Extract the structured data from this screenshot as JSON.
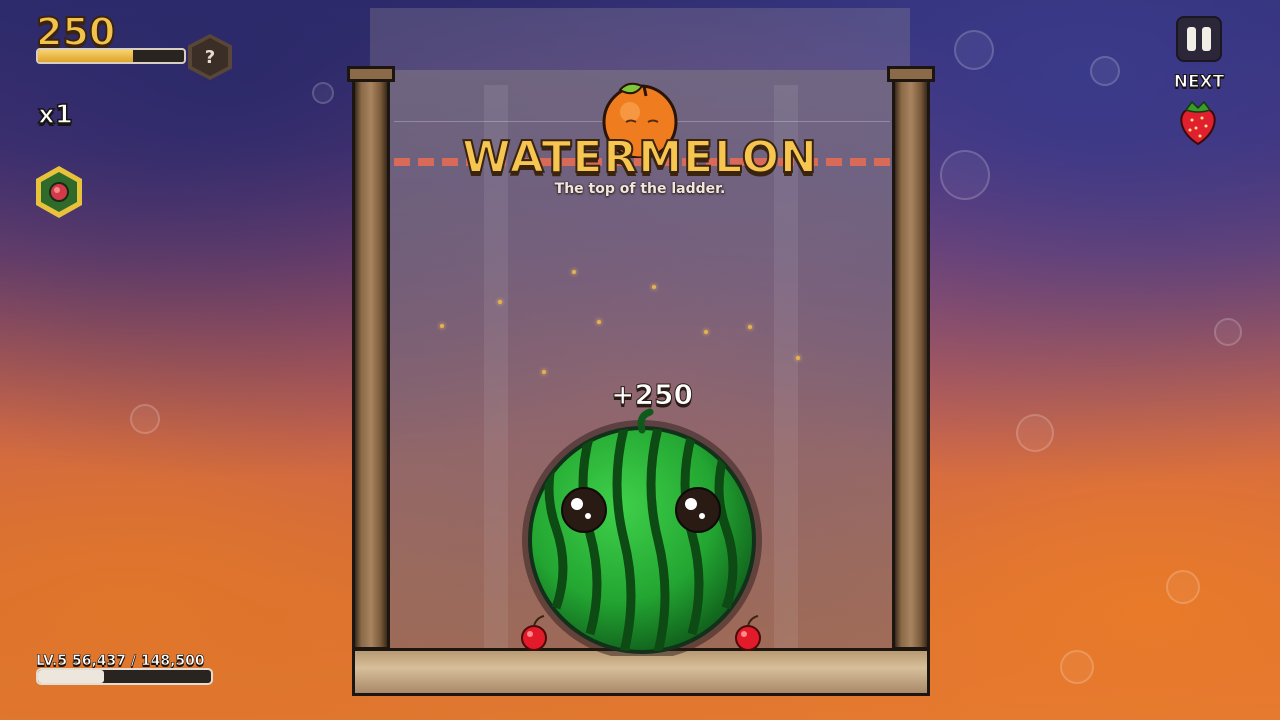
{
  "hud": {
    "score": "250",
    "score_progress": 0.65,
    "mystery_badge_label": "?",
    "multiplier": "x1",
    "powerup_icon": "melon-powerup-icon",
    "pause_icon": "pause-icon",
    "next_label": "NEXT",
    "next_fruit_icon": "strawberry-icon",
    "level_text": "LV.5 56,437 / 148,500",
    "level_progress": 0.38
  },
  "banner": {
    "title": "WATERMELON",
    "subtitle": "The top of the ladder."
  },
  "popup": {
    "points": "+250"
  },
  "fruits": {
    "dropper": "orange-icon",
    "main": "watermelon-icon",
    "small": [
      "cherry-icon",
      "cherry-icon"
    ]
  },
  "colors": {
    "score_gold": "#f3c24c",
    "title_gold": "#f6c651",
    "danger_line": "#d86a5a",
    "watermelon_green": "#2fa83a"
  }
}
